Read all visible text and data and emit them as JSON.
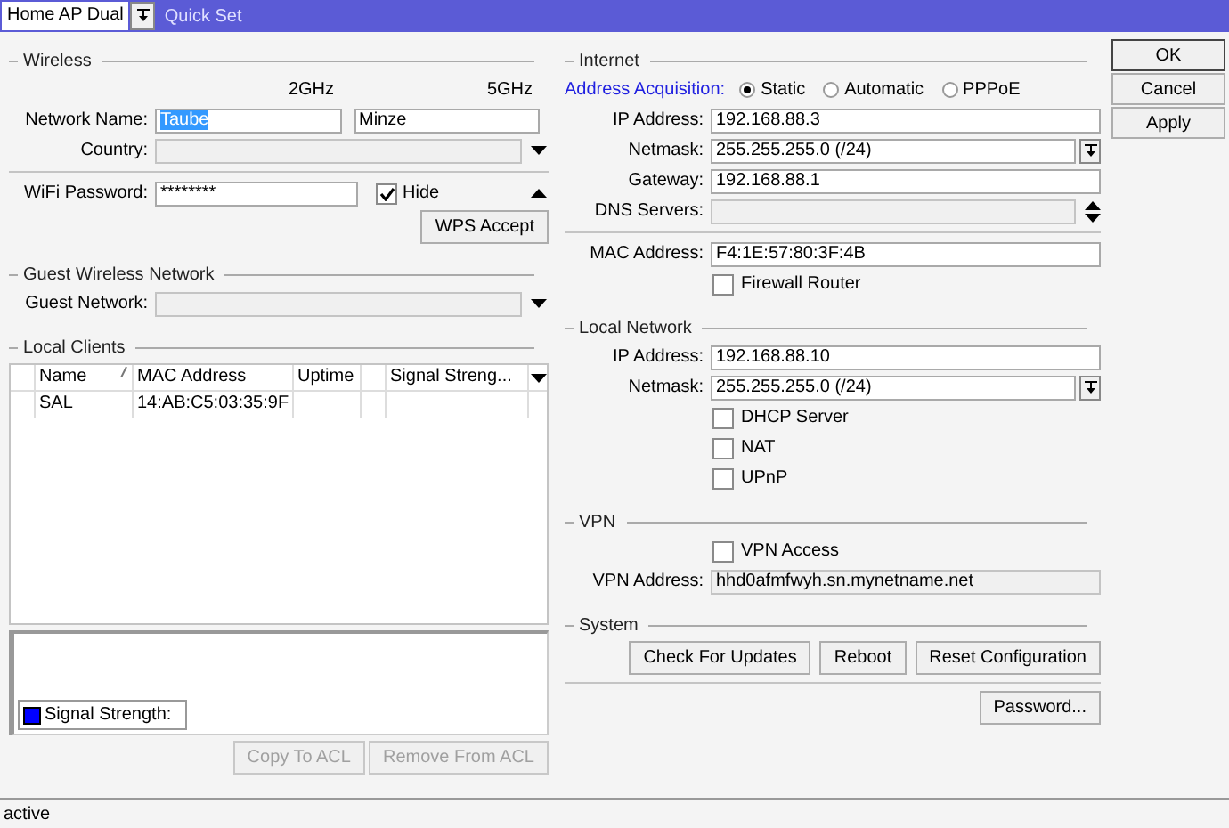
{
  "toolbar": {
    "mode": "Home AP Dual",
    "title": "Quick Set"
  },
  "left_sections": [
    {
      "title": "Wireless",
      "rows": [
        {
          "kind": "bands",
          "headers": [
            "2GHz",
            "5GHz"
          ]
        },
        {
          "kind": "names",
          "label": "Network Name:",
          "values": [
            {
              "value": "Taube",
              "selected": true
            },
            {
              "value": "Minze",
              "selected": false
            }
          ]
        },
        {
          "kind": "dropdown",
          "label": "Country:"
        },
        {
          "kind": "rule"
        },
        {
          "kind": "password",
          "label": "WiFi Password:",
          "value": "********",
          "hide": {
            "label": "Hide",
            "checked": true
          }
        },
        {
          "kind": "buttons",
          "buttons": [
            {
              "label": "WPS Accept",
              "disabled": false
            }
          ]
        }
      ]
    },
    {
      "title": "Guest Wireless Network",
      "rows": [
        {
          "kind": "dropdown",
          "label": "Guest Network:"
        }
      ]
    }
  ],
  "local_clients": {
    "title": "Local Clients",
    "columns": [
      {
        "label": "Name",
        "sorted": true
      },
      {
        "label": "MAC Address",
        "sorted": false
      },
      {
        "label": "Uptime",
        "sorted": false
      },
      {
        "label": "Signal Streng...",
        "sorted": false
      }
    ],
    "rows": [
      {
        "cells": [
          "SAL",
          "14:AB:C5:03:35:9F"
        ]
      }
    ],
    "legend": {
      "label": "Signal Strength:",
      "color": "#0000ff"
    },
    "buttons": [
      {
        "label": "Copy To ACL",
        "disabled": true
      },
      {
        "label": "Remove From ACL",
        "disabled": true
      }
    ]
  },
  "right_sections": [
    {
      "title": "Internet",
      "rows": [
        {
          "kind": "radios",
          "label": "Address Acquisition:",
          "options": [
            {
              "label": "Static",
              "selected": true
            },
            {
              "label": "Automatic",
              "selected": false
            },
            {
              "label": "PPPoE",
              "selected": false
            }
          ]
        },
        {
          "kind": "text",
          "label": "IP Address:",
          "value": "192.168.88.3"
        },
        {
          "kind": "select",
          "label": "Netmask:",
          "value": "255.255.255.0 (/24)"
        },
        {
          "kind": "text",
          "label": "Gateway:",
          "value": "192.168.88.1"
        },
        {
          "kind": "spin",
          "label": "DNS Servers:"
        },
        {
          "kind": "rule"
        },
        {
          "kind": "text",
          "label": "MAC Address:",
          "value": "F4:1E:57:80:3F:4B"
        },
        {
          "kind": "check",
          "label": "Firewall Router",
          "checked": false
        }
      ]
    },
    {
      "title": "Local Network",
      "rows": [
        {
          "kind": "text",
          "label": "IP Address:",
          "value": "192.168.88.10"
        },
        {
          "kind": "select",
          "label": "Netmask:",
          "value": "255.255.255.0 (/24)"
        },
        {
          "kind": "check",
          "label": "DHCP Server",
          "checked": false
        },
        {
          "kind": "check",
          "label": "NAT",
          "checked": false
        },
        {
          "kind": "check",
          "label": "UPnP",
          "checked": false
        }
      ]
    },
    {
      "title": "VPN",
      "rows": [
        {
          "kind": "check",
          "label": "VPN Access",
          "checked": false
        },
        {
          "kind": "readonly",
          "label": "VPN Address:",
          "value": "hhd0afmfwyh.sn.mynetname.net"
        }
      ]
    },
    {
      "title": "System",
      "rows": [
        {
          "kind": "buttons",
          "buttons": [
            {
              "label": "Check For Updates",
              "disabled": false
            },
            {
              "label": "Reboot",
              "disabled": false
            },
            {
              "label": "Reset Configuration",
              "disabled": false
            }
          ]
        },
        {
          "kind": "rule"
        },
        {
          "kind": "buttons",
          "buttons": [
            {
              "label": "Password...",
              "disabled": false
            }
          ]
        }
      ]
    }
  ],
  "dialog_buttons": [
    {
      "label": "OK",
      "default": true
    },
    {
      "label": "Cancel",
      "default": false
    },
    {
      "label": "Apply",
      "default": false
    }
  ],
  "status_bar": "active"
}
